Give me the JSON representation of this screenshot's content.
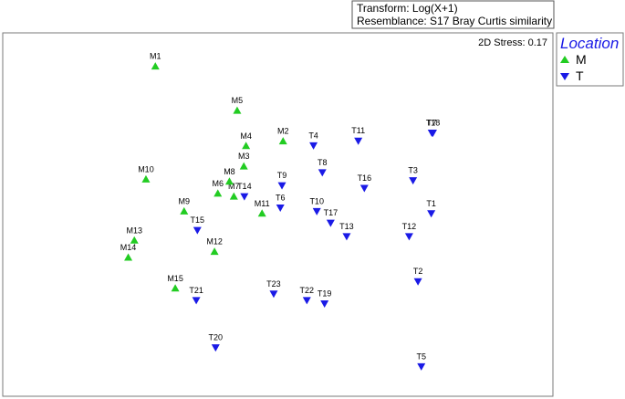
{
  "header": {
    "transform": "Transform: Log(X+1)",
    "resemblance": "Resemblance: S17 Bray Curtis similarity"
  },
  "chart_data": {
    "type": "scatter",
    "stress_text": "2D Stress: 0.17",
    "legend": {
      "title": "Location",
      "placement": "right",
      "entries": [
        {
          "name": "M",
          "shape": "triangle-up",
          "color": "#22cc22"
        },
        {
          "name": "T",
          "shape": "triangle-down",
          "color": "#1a1ae6"
        }
      ]
    },
    "xlim": [
      0,
      1
    ],
    "ylim": [
      0,
      1
    ],
    "series": [
      {
        "name": "M",
        "points": [
          {
            "label": "M1",
            "x": 0.276,
            "y": 0.908
          },
          {
            "label": "M2",
            "x": 0.507,
            "y": 0.702
          },
          {
            "label": "M3",
            "x": 0.436,
            "y": 0.633
          },
          {
            "label": "M4",
            "x": 0.44,
            "y": 0.689
          },
          {
            "label": "M5",
            "x": 0.424,
            "y": 0.786
          },
          {
            "label": "M6",
            "x": 0.389,
            "y": 0.558
          },
          {
            "label": "M7",
            "x": 0.418,
            "y": 0.55
          },
          {
            "label": "M8",
            "x": 0.41,
            "y": 0.591
          },
          {
            "label": "M9",
            "x": 0.328,
            "y": 0.509
          },
          {
            "label": "M10",
            "x": 0.259,
            "y": 0.597
          },
          {
            "label": "M11",
            "x": 0.469,
            "y": 0.503
          },
          {
            "label": "M12",
            "x": 0.383,
            "y": 0.398
          },
          {
            "label": "M13",
            "x": 0.238,
            "y": 0.429
          },
          {
            "label": "M14",
            "x": 0.227,
            "y": 0.382
          },
          {
            "label": "M15",
            "x": 0.312,
            "y": 0.297
          }
        ]
      },
      {
        "name": "T",
        "points": [
          {
            "label": "T1",
            "x": 0.775,
            "y": 0.503
          },
          {
            "label": "T2",
            "x": 0.751,
            "y": 0.316
          },
          {
            "label": "T3",
            "x": 0.742,
            "y": 0.594
          },
          {
            "label": "T4",
            "x": 0.562,
            "y": 0.69
          },
          {
            "label": "T5",
            "x": 0.757,
            "y": 0.082
          },
          {
            "label": "T6",
            "x": 0.502,
            "y": 0.519
          },
          {
            "label": "T7",
            "x": 0.776,
            "y": 0.725
          },
          {
            "label": "T8",
            "x": 0.578,
            "y": 0.616
          },
          {
            "label": "T9",
            "x": 0.505,
            "y": 0.58
          },
          {
            "label": "T10",
            "x": 0.568,
            "y": 0.509
          },
          {
            "label": "T11",
            "x": 0.643,
            "y": 0.703
          },
          {
            "label": "T12",
            "x": 0.735,
            "y": 0.44
          },
          {
            "label": "T13",
            "x": 0.622,
            "y": 0.44
          },
          {
            "label": "T14",
            "x": 0.437,
            "y": 0.55
          },
          {
            "label": "T15",
            "x": 0.352,
            "y": 0.457
          },
          {
            "label": "T16",
            "x": 0.654,
            "y": 0.573
          },
          {
            "label": "T17",
            "x": 0.593,
            "y": 0.477
          },
          {
            "label": "T18",
            "x": 0.778,
            "y": 0.725
          },
          {
            "label": "T19",
            "x": 0.582,
            "y": 0.255
          },
          {
            "label": "T20",
            "x": 0.385,
            "y": 0.134
          },
          {
            "label": "T21",
            "x": 0.35,
            "y": 0.264
          },
          {
            "label": "T22",
            "x": 0.55,
            "y": 0.264
          },
          {
            "label": "T23",
            "x": 0.49,
            "y": 0.282
          }
        ]
      }
    ]
  }
}
